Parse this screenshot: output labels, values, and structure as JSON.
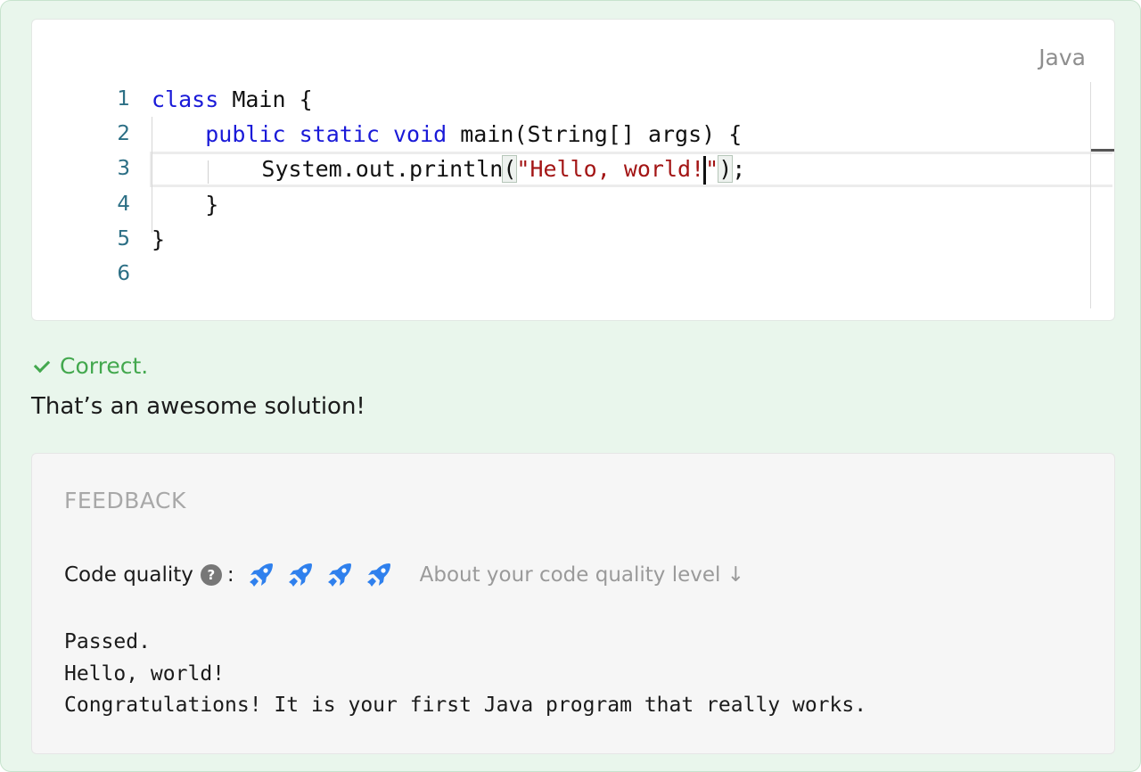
{
  "editor": {
    "language": "Java",
    "line_numbers": [
      "1",
      "2",
      "3",
      "4",
      "5",
      "6"
    ],
    "code": {
      "l1_kw": "class",
      "l1_rest": " Main {",
      "l2_indent": "    ",
      "l2_kw1": "public",
      "l2_kw2": "static",
      "l2_kw3": "void",
      "l2_rest": " main(String[] args) {",
      "l3_indent": "        ",
      "l3_call": "System.out.println",
      "l3_open": "(",
      "l3_str1": "\"Hello, world!",
      "l3_str2": "\"",
      "l3_close": ")",
      "l3_end": ";",
      "l4_text": "    }",
      "l5_text": "}"
    }
  },
  "result": {
    "status": "Correct.",
    "message": "That’s an awesome solution!"
  },
  "feedback": {
    "title": "FEEDBACK",
    "code_quality_label": "Code quality",
    "help_icon_glyph": "?",
    "colon": ":",
    "rockets": 4,
    "rocket_color": "#2f80ed",
    "about_link": "About your code quality level ↓",
    "output_lines": [
      "Passed.",
      "Hello, world!",
      "Congratulations! It is your first Java program that really works."
    ]
  },
  "colors": {
    "background": "#e9f6ec",
    "success": "#43a84e",
    "keyword": "#1a1ad8",
    "string": "#a31515",
    "line_number": "#2c6f85"
  }
}
